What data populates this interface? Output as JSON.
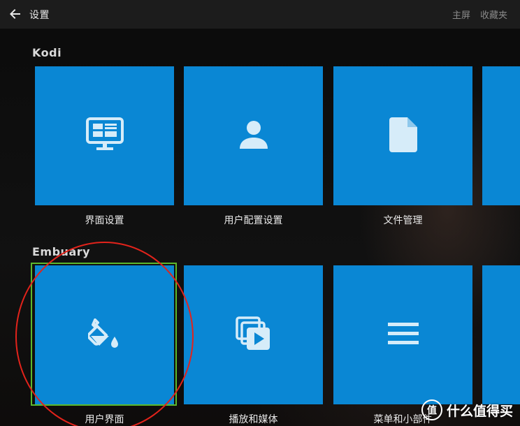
{
  "header": {
    "title": "设置",
    "nav": [
      "主屏",
      "收藏夹"
    ]
  },
  "sections": [
    {
      "label": "Kodi",
      "tiles": [
        {
          "label": "界面设置",
          "icon": "monitor-icon"
        },
        {
          "label": "用户配置设置",
          "icon": "user-icon"
        },
        {
          "label": "文件管理",
          "icon": "file-icon"
        },
        {
          "label": "",
          "icon": ""
        }
      ]
    },
    {
      "label": "Embuary",
      "tiles": [
        {
          "label": "用户界面",
          "icon": "paint-bucket-icon"
        },
        {
          "label": "播放和媒体",
          "icon": "media-play-icon"
        },
        {
          "label": "菜单和小部件",
          "icon": "menu-icon"
        },
        {
          "label": "",
          "icon": ""
        }
      ]
    }
  ],
  "watermark": {
    "text": "什么值得买",
    "badge": "值"
  },
  "colors": {
    "tile": "#0a87d4",
    "focus": "#5cb82d",
    "annotation": "#e3231b",
    "topbar": "#1c1c1c"
  }
}
